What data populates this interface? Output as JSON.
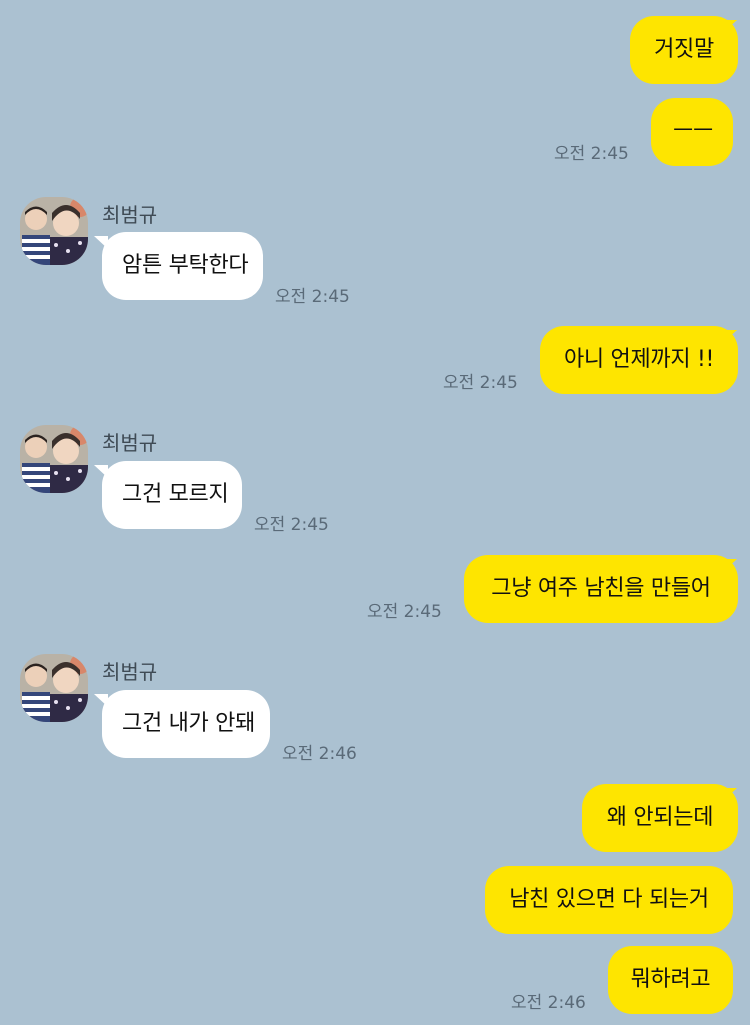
{
  "colors": {
    "background": "#abc1d1",
    "my_bubble": "#fee500",
    "other_bubble": "#ffffff",
    "time_text": "#5a6a78"
  },
  "contact_name": "최범규",
  "messages": [
    {
      "sender": "me",
      "text": "거짓말"
    },
    {
      "sender": "me",
      "text": "ㅡㅡ",
      "time": "오전 2:45"
    },
    {
      "sender": "other",
      "text": "암튼 부탁한다",
      "time": "오전 2:45"
    },
    {
      "sender": "me",
      "text": "아니 언제까지 !!",
      "time": "오전 2:45"
    },
    {
      "sender": "other",
      "text": "그건 모르지",
      "time": "오전 2:45"
    },
    {
      "sender": "me",
      "text": "그냥 여주 남친을 만들어",
      "time": "오전 2:45"
    },
    {
      "sender": "other",
      "text": "그건 내가 안돼",
      "time": "오전 2:46"
    },
    {
      "sender": "me",
      "text": "왜 안되는데"
    },
    {
      "sender": "me",
      "text": "남친 있으면 다 되는거"
    },
    {
      "sender": "me",
      "text": "뭐하려고",
      "time": "오전 2:46"
    }
  ]
}
